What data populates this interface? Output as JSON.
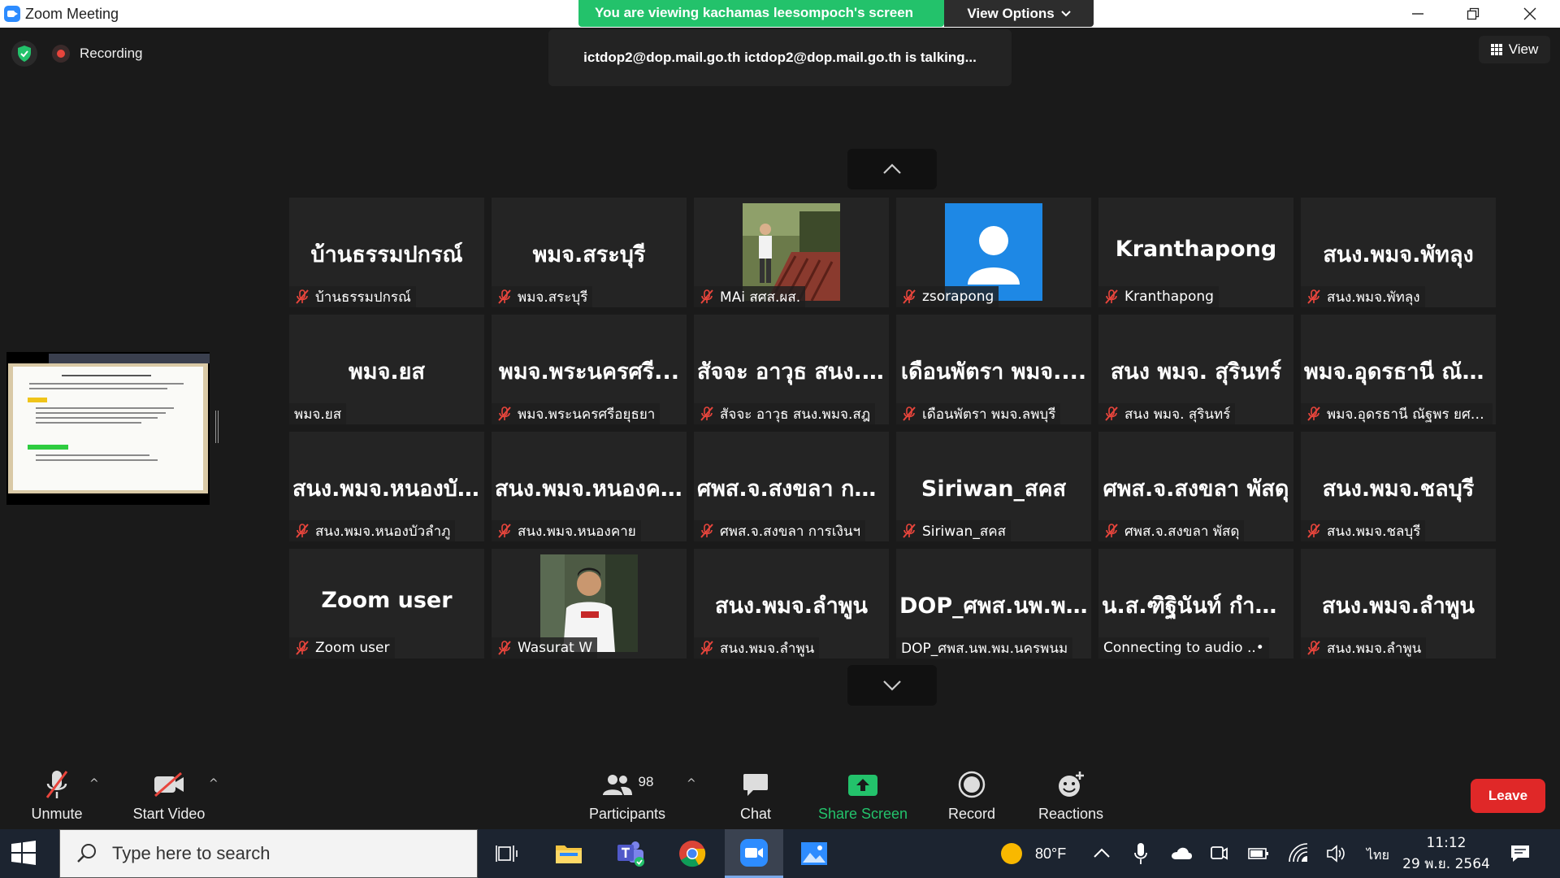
{
  "window": {
    "title": "Zoom Meeting",
    "share_banner": "You are viewing kachamas leesompoch's screen",
    "view_options": "View Options"
  },
  "top": {
    "recording_label": "Recording",
    "talking": "ictdop2@dop.mail.go.th ictdop2@dop.mail.go.th is talking...",
    "view_label": "View"
  },
  "tiles": [
    {
      "big": "บ้านธรรมปกรณ์",
      "label": "บ้านธรรมปกรณ์",
      "muted": true
    },
    {
      "big": "พมจ.สระบุรี",
      "label": "พมจ.สระบุรี",
      "muted": true
    },
    {
      "big": "",
      "label": "MAi สศส.ผส.",
      "muted": true,
      "photo": "person-outdoor"
    },
    {
      "big": "",
      "label": "zsorapong",
      "muted": true,
      "photo": "avatar"
    },
    {
      "big": "Kranthapong",
      "label": "Kranthapong",
      "muted": true
    },
    {
      "big": "สนง.พมจ.พัทลุง",
      "label": "สนง.พมจ.พัทลุง",
      "muted": true
    },
    {
      "big": "พมจ.ยส",
      "label": "พมจ.ยส",
      "muted": false
    },
    {
      "big": "พมจ.พระนครศรี...",
      "label": "พมจ.พระนครศรีอยุธยา",
      "muted": true
    },
    {
      "big": "สัจจะ อาวุธ สนง....",
      "label": "สัจจะ อาวุธ สนง.พมจ.สฎ",
      "muted": true
    },
    {
      "big": "เดือนพัตรา พมจ....",
      "label": "เดือนพัตรา พมจ.ลพบุรี",
      "muted": true
    },
    {
      "big": "สนง พมจ. สุรินทร์",
      "label": "สนง พมจ. สุรินทร์",
      "muted": true
    },
    {
      "big": "พมจ.อุดรธานี ณัฐ...",
      "label": "พมจ.อุดรธานี ณัฐพร ยศสู...",
      "muted": true
    },
    {
      "big": "สนง.พมจ.หนองบั...",
      "label": "สนง.พมจ.หนองบัวลำภู",
      "muted": true
    },
    {
      "big": "สนง.พมจ.หนองค...",
      "label": "สนง.พมจ.หนองคาย",
      "muted": true
    },
    {
      "big": "ศพส.จ.สงขลา กา...",
      "label": "ศพส.จ.สงขลา การเงินฯ",
      "muted": true
    },
    {
      "big": "Siriwan_สคส",
      "label": "Siriwan_สคส",
      "muted": true
    },
    {
      "big": "ศพส.จ.สงขลา พัสดุ",
      "label": "ศพส.จ.สงขลา พัสดุ",
      "muted": true
    },
    {
      "big": "สนง.พมจ.ชลบุรี",
      "label": "สนง.พมจ.ชลบุรี",
      "muted": true
    },
    {
      "big": "Zoom user",
      "label": "Zoom user",
      "muted": true
    },
    {
      "big": "",
      "label": "Wasurat W",
      "muted": true,
      "photo": "person-shirt"
    },
    {
      "big": "สนง.พมจ.ลำพูน",
      "label": "สนง.พมจ.ลำพูน",
      "muted": true
    },
    {
      "big": "DOP_ศพส.นพ.พ...",
      "label": "DOP_ศพส.นพ.พม.นครพนม",
      "muted": false
    },
    {
      "big": "น.ส.ฑิฐินันท์ กำแ...",
      "label": "Connecting to audio ..•",
      "muted": false
    },
    {
      "big": "สนง.พมจ.ลำพูน",
      "label": "สนง.พมจ.ลำพูน",
      "muted": true
    }
  ],
  "toolbar": {
    "unmute": "Unmute",
    "start_video": "Start Video",
    "participants": "Participants",
    "participants_count": "98",
    "chat": "Chat",
    "share_screen": "Share Screen",
    "record": "Record",
    "reactions": "Reactions",
    "leave": "Leave"
  },
  "colors": {
    "share_green": "#23c26b",
    "leave_red": "#e02828",
    "mute_red": "#e8453c",
    "zoom_blue": "#2d8cff"
  },
  "taskbar": {
    "search_placeholder": "Type here to search",
    "weather": "80°F",
    "lang": "ไทย",
    "time": "11:12",
    "date": "29 พ.ย. 2564"
  }
}
